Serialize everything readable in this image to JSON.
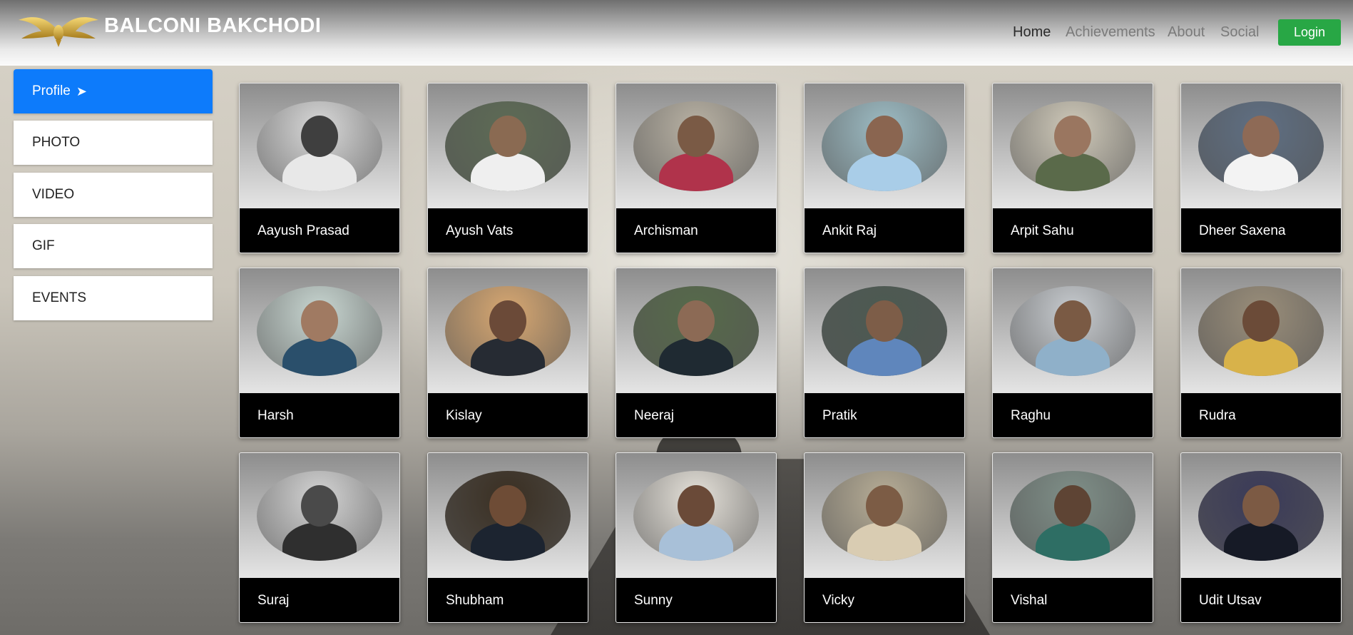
{
  "header": {
    "brand": "BALCONI BAKCHODI",
    "logo_icon": "golden-wings-logo-icon",
    "nav": [
      {
        "label": "Home",
        "active": true
      },
      {
        "label": "Achievements",
        "active": false
      },
      {
        "label": "About",
        "active": false
      },
      {
        "label": "Social",
        "active": false
      }
    ],
    "login_label": "Login"
  },
  "sidebar": {
    "items": [
      {
        "label": "Profile",
        "active": true,
        "icon": "arrow-right-icon",
        "icon_glyph": "➤"
      },
      {
        "label": "PHOTO",
        "active": false
      },
      {
        "label": "VIDEO",
        "active": false
      },
      {
        "label": "GIF",
        "active": false
      },
      {
        "label": "EVENTS",
        "active": false
      }
    ]
  },
  "profiles": [
    {
      "name": "Aayush Prasad",
      "bg": "#d9d9d9",
      "skin": "#3f3f3f",
      "shirt": "#e8e8e8"
    },
    {
      "name": "Ayush Vats",
      "bg": "#5d6b55",
      "skin": "#8a6a52",
      "shirt": "#efefef"
    },
    {
      "name": "Archisman",
      "bg": "#b9b2a4",
      "skin": "#7a5a45",
      "shirt": "#b0334b"
    },
    {
      "name": "Ankit Raj",
      "bg": "#9dbcc4",
      "skin": "#8a6550",
      "shirt": "#a9cde8"
    },
    {
      "name": "Arpit Sahu",
      "bg": "#cfc9b9",
      "skin": "#9a7660",
      "shirt": "#5a6a4a"
    },
    {
      "name": "Dheer Saxena",
      "bg": "#5f6f83",
      "skin": "#8e6a56",
      "shirt": "#f3f3f3"
    },
    {
      "name": "Harsh",
      "bg": "#c9d7d2",
      "skin": "#a07a62",
      "shirt": "#2a4f6b"
    },
    {
      "name": "Kislay",
      "bg": "#d8a872",
      "skin": "#6b4a38",
      "shirt": "#262b33"
    },
    {
      "name": "Neeraj",
      "bg": "#566a4a",
      "skin": "#8c6a55",
      "shirt": "#1f2a32"
    },
    {
      "name": "Pratik",
      "bg": "#4c5a52",
      "skin": "#7d5d48",
      "shirt": "#5f86bc"
    },
    {
      "name": "Raghu",
      "bg": "#c8ccd0",
      "skin": "#7a5a44",
      "shirt": "#8fb0c9"
    },
    {
      "name": "Rudra",
      "bg": "#9a8e7a",
      "skin": "#6b4b38",
      "shirt": "#d8b24a"
    },
    {
      "name": "Suraj",
      "bg": "#d4d4d4",
      "skin": "#4a4a4a",
      "shirt": "#2f2f2f"
    },
    {
      "name": "Shubham",
      "bg": "#3a2f22",
      "skin": "#6e4c36",
      "shirt": "#1c2430"
    },
    {
      "name": "Sunny",
      "bg": "#e6e2da",
      "skin": "#6a4a38",
      "shirt": "#a8c0d8"
    },
    {
      "name": "Vicky",
      "bg": "#b7ad96",
      "skin": "#7c5c45",
      "shirt": "#d9ccb2"
    },
    {
      "name": "Vishal",
      "bg": "#7f8f88",
      "skin": "#5e4434",
      "shirt": "#2e6e64"
    },
    {
      "name": "Udit Utsav",
      "bg": "#3a3a58",
      "skin": "#7c5a44",
      "shirt": "#161a26"
    }
  ]
}
